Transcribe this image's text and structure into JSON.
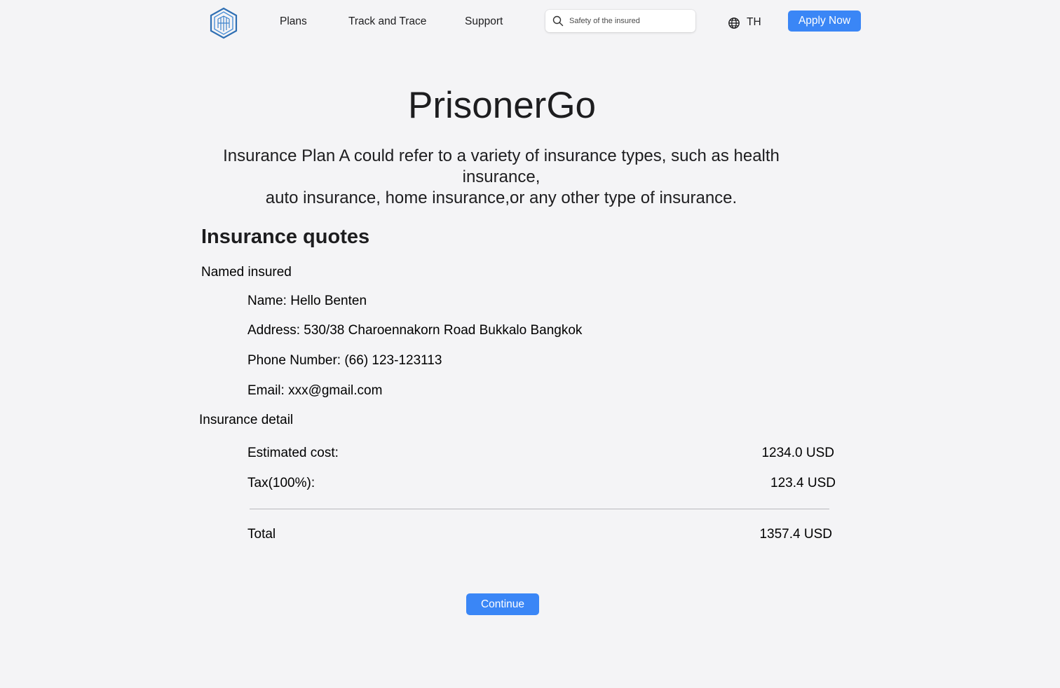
{
  "header": {
    "nav": [
      "Plans",
      "Track and Trace",
      "Support"
    ],
    "search_placeholder": "Safety of the insured",
    "language": "TH",
    "apply_label": "Apply Now"
  },
  "hero": {
    "title": "PrisonerGo",
    "description_line1": "Insurance Plan A could refer to a variety of insurance types, such as health insurance,",
    "description_line2": "auto insurance, home insurance,or any other type of insurance."
  },
  "quote": {
    "title": "Insurance quotes",
    "named_insured": {
      "heading": "Named insured",
      "name": "Name: Hello  Benten",
      "address": "Address: 530/38 Charoennakorn Road Bukkalo Bangkok",
      "phone": "Phone Number: (66) 123-123113",
      "email": "Email: xxx@gmail.com"
    },
    "detail": {
      "heading": "Insurance detail",
      "estimated_label": "Estimated cost:",
      "estimated_value": "1234.0 USD",
      "tax_label": "Tax(100%):",
      "tax_value": "123.4 USD",
      "total_label": "Total",
      "total_value": "1357.4 USD"
    },
    "continue_label": "Continue"
  },
  "colors": {
    "accent": "#3a86f6",
    "background": "#f4f4f6",
    "logo": "#2f6fb3"
  },
  "icons": [
    "hexagon-logo-icon",
    "search-icon",
    "globe-icon"
  ]
}
